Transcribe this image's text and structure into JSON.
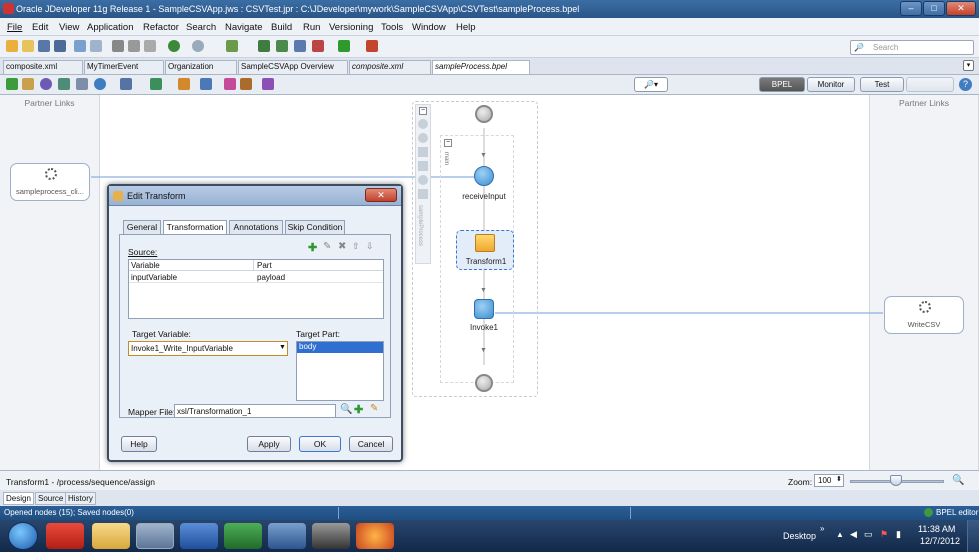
{
  "window": {
    "title": "Oracle JDeveloper 11g Release 1 - SampleCSVApp.jws : CSVTest.jpr : C:\\JDeveloper\\mywork\\SampleCSVApp\\CSVTest\\sampleProcess.bpel"
  },
  "menu": [
    "File",
    "Edit",
    "View",
    "Application",
    "Refactor",
    "Search",
    "Navigate",
    "Build",
    "Run",
    "Versioning",
    "Tools",
    "Window",
    "Help"
  ],
  "search": {
    "placeholder": "Search"
  },
  "tabs": [
    "composite.xml",
    "MyTimerEvent",
    "Organization",
    "SampleCSVApp Overview",
    "composite.xml",
    "sampleProcess.bpel"
  ],
  "editor_toolbar": {
    "bpel": "BPEL",
    "monitor": "Monitor",
    "test": "Test"
  },
  "canvas": {
    "left_lane_label": "Partner Links",
    "right_lane_label": "Partner Links",
    "left_partner": "sampleprocess_cli...",
    "right_partner": "WriteCSV",
    "scope_label": "main",
    "sequence_label": "sampleProcess",
    "nodes": [
      "receiveInput",
      "Transform1",
      "Invoke1"
    ]
  },
  "dialog": {
    "title": "Edit Transform",
    "tabs": [
      "General",
      "Transformation",
      "Annotations",
      "Skip Condition"
    ],
    "source_label": "Source:",
    "columns": [
      "Variable",
      "Part"
    ],
    "rows": [
      {
        "variable": "inputVariable",
        "part": "payload"
      }
    ],
    "target_variable_label": "Target Variable:",
    "target_variable_value": "Invoke1_Write_InputVariable",
    "target_part_label": "Target Part:",
    "target_part_value": "body",
    "mapper_label": "Mapper File:",
    "mapper_value": "xsl/Transformation_1",
    "buttons": {
      "help": "Help",
      "apply": "Apply",
      "ok": "OK",
      "cancel": "Cancel"
    }
  },
  "status": {
    "path": "Transform1 - /process/sequence/assign",
    "zoom_label": "Zoom:",
    "zoom_value": "100",
    "bottom_tabs": [
      "Design",
      "Source",
      "History"
    ],
    "opened_nodes": "Opened nodes (15); Saved nodes(0)",
    "editor_label": "BPEL editor"
  },
  "taskbar": {
    "desktop": "Desktop",
    "time": "11:38 AM",
    "date": "12/7/2012"
  },
  "colors": {
    "accent": "#3d7fd8",
    "selection": "#2f6fd0"
  }
}
